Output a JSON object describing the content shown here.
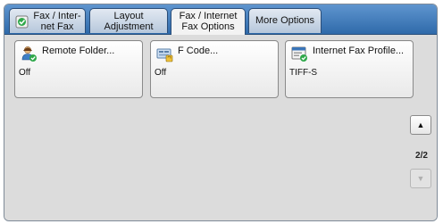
{
  "tabs": [
    {
      "line1": "Fax / Inter-",
      "line2": "net Fax",
      "icon": "fax-internet-fax-icon"
    },
    {
      "line1": "Layout",
      "line2": "Adjustment"
    },
    {
      "line1": "Fax / Internet",
      "line2": "Fax Options",
      "active": true
    },
    {
      "line1": "More Options"
    }
  ],
  "buttons": [
    {
      "title": "Remote Folder...",
      "value": "Off",
      "icon": "remote-folder-icon"
    },
    {
      "title": "F Code...",
      "value": "Off",
      "icon": "f-code-icon"
    },
    {
      "title": "Internet Fax Profile...",
      "value": "TIFF-S",
      "icon": "internet-fax-profile-icon"
    }
  ],
  "scroll": {
    "up": "▲",
    "down": "▼",
    "page": "2/2"
  },
  "colors": {
    "tab_bar": "#3a75b8",
    "panel_bg": "#dcdcdc",
    "accent_green": "#2fa84a"
  }
}
